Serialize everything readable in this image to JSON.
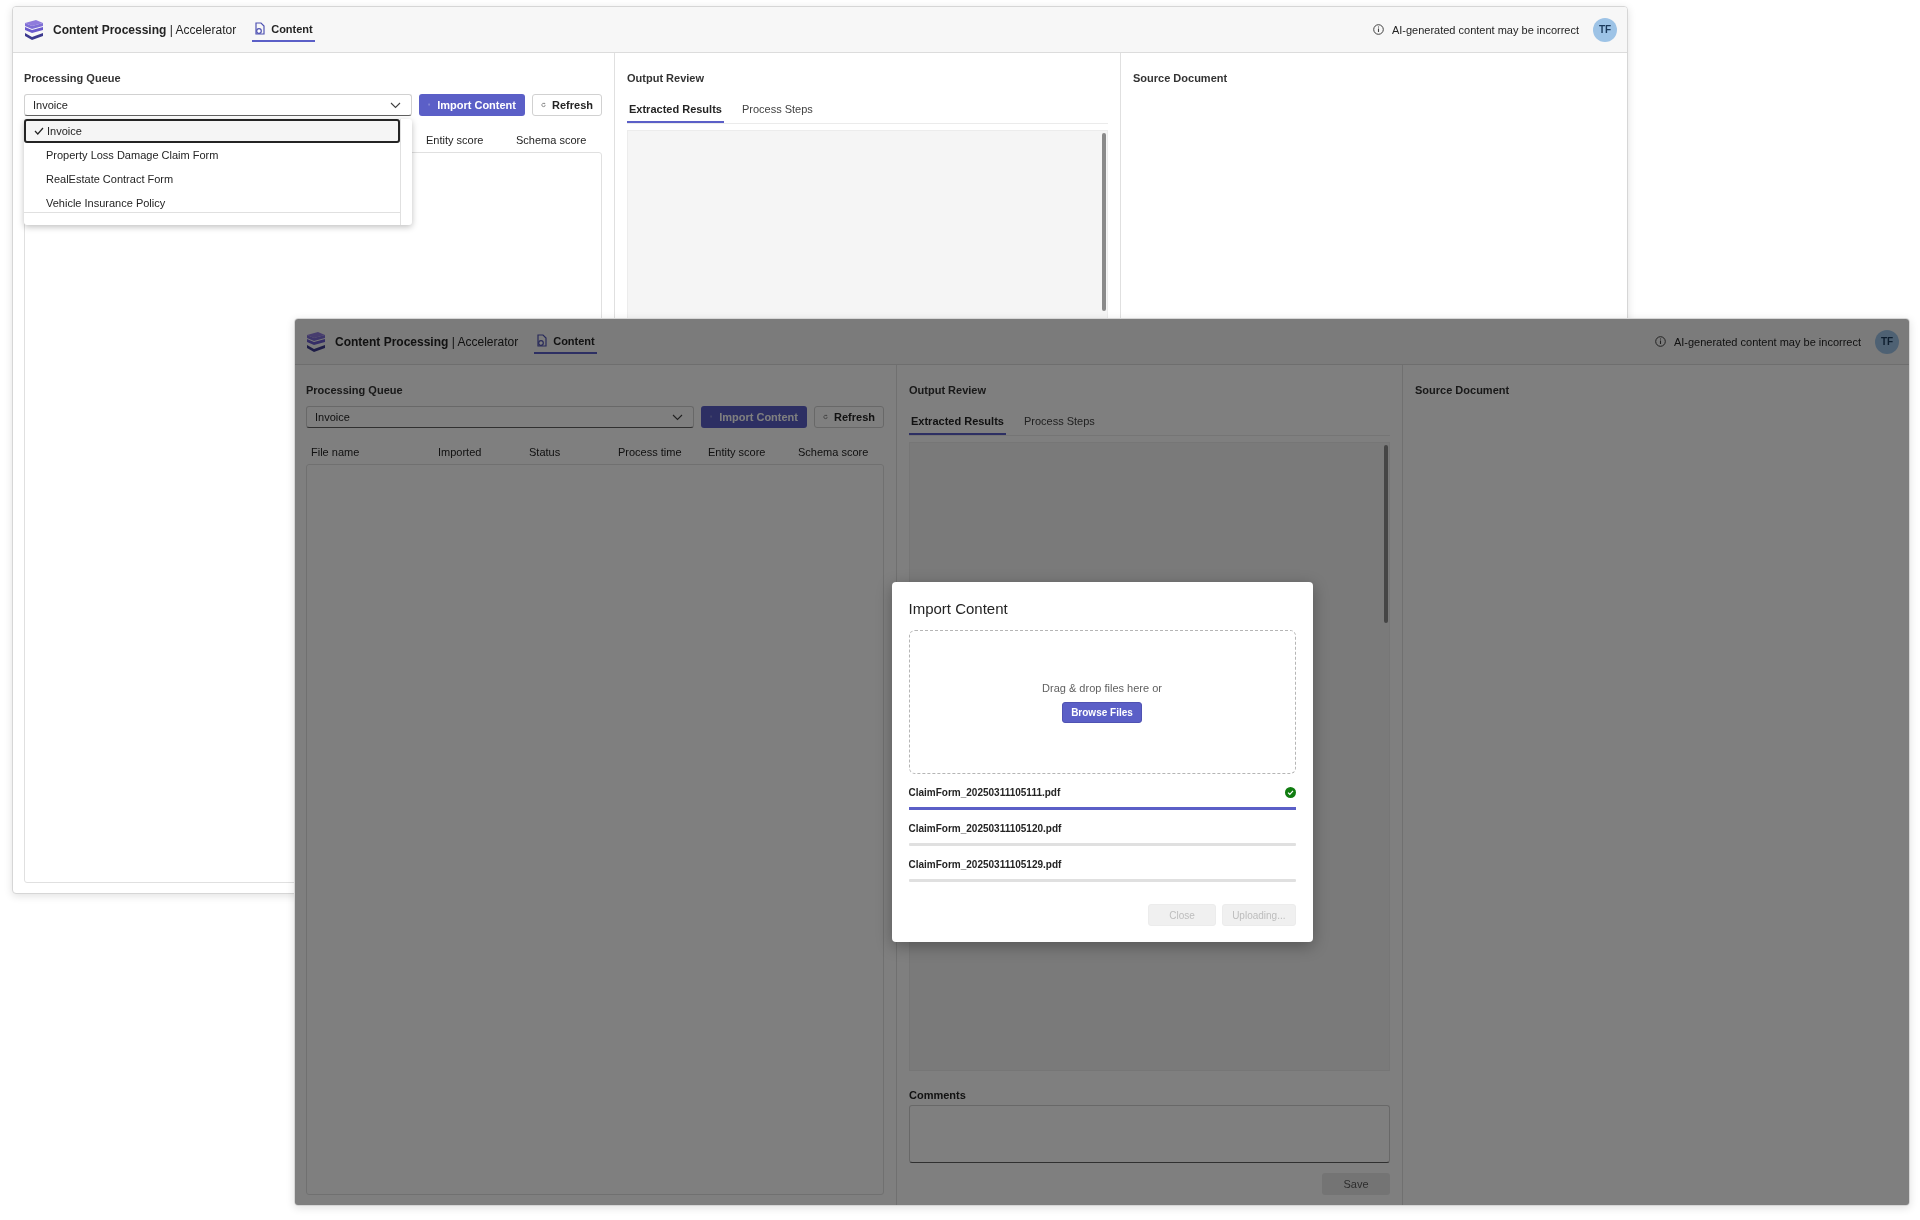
{
  "windows": [
    {
      "header": {
        "brand": "**Content Processing** | Accelerator",
        "nav_tab": {
          "label": "Content",
          "selected": true
        },
        "notice": "AI-generated content may be incorrect",
        "avatar": "TF"
      },
      "queue": {
        "title": "Processing Queue",
        "select_value": "Invoice",
        "import_button": "Import Content",
        "refresh_button": "Refresh",
        "columns": [
          "Entity score",
          "Schema score"
        ],
        "dropdown_options": [
          {
            "label": "Invoice",
            "selected": true
          },
          {
            "label": "Property Loss Damage Claim Form",
            "selected": false
          },
          {
            "label": "RealEstate Contract Form",
            "selected": false
          },
          {
            "label": "Vehicle Insurance Policy",
            "selected": false
          }
        ]
      },
      "output": {
        "title": "Output Review",
        "tabs": [
          {
            "label": "Extracted Results",
            "selected": true
          },
          {
            "label": "Process Steps",
            "selected": false
          }
        ]
      },
      "source": {
        "title": "Source Document"
      }
    },
    {
      "dimmed": true,
      "header": {
        "brand": "**Content Processing** | Accelerator",
        "nav_tab": {
          "label": "Content",
          "selected": true
        },
        "notice": "AI-generated content may be incorrect",
        "avatar": "TF"
      },
      "queue": {
        "title": "Processing Queue",
        "select_value": "Invoice",
        "import_button": "Import Content",
        "refresh_button": "Refresh",
        "columns": [
          "File name",
          "Imported",
          "Status",
          "Process time",
          "Entity score",
          "Schema score"
        ]
      },
      "output": {
        "title": "Output Review",
        "tabs": [
          {
            "label": "Extracted Results",
            "selected": true
          },
          {
            "label": "Process Steps",
            "selected": false
          }
        ],
        "comments": {
          "label": "Comments",
          "save_button": "Save",
          "save_disabled": true
        }
      },
      "source": {
        "title": "Source Document"
      },
      "dialog": {
        "title": "Import Content",
        "drop_hint": "Drag & drop files here or",
        "browse_button": "Browse Files",
        "files": [
          {
            "name": "ClaimForm_20250311105111.pdf",
            "level": 1,
            "done": true
          },
          {
            "name": "ClaimForm_20250311105120.pdf",
            "level": 0,
            "done": false
          },
          {
            "name": "ClaimForm_20250311105129.pdf",
            "level": 0,
            "done": false
          }
        ],
        "buttons": [
          {
            "label": "Close",
            "disabled": true
          },
          {
            "label": "Uploading...",
            "disabled": true
          }
        ]
      }
    }
  ]
}
